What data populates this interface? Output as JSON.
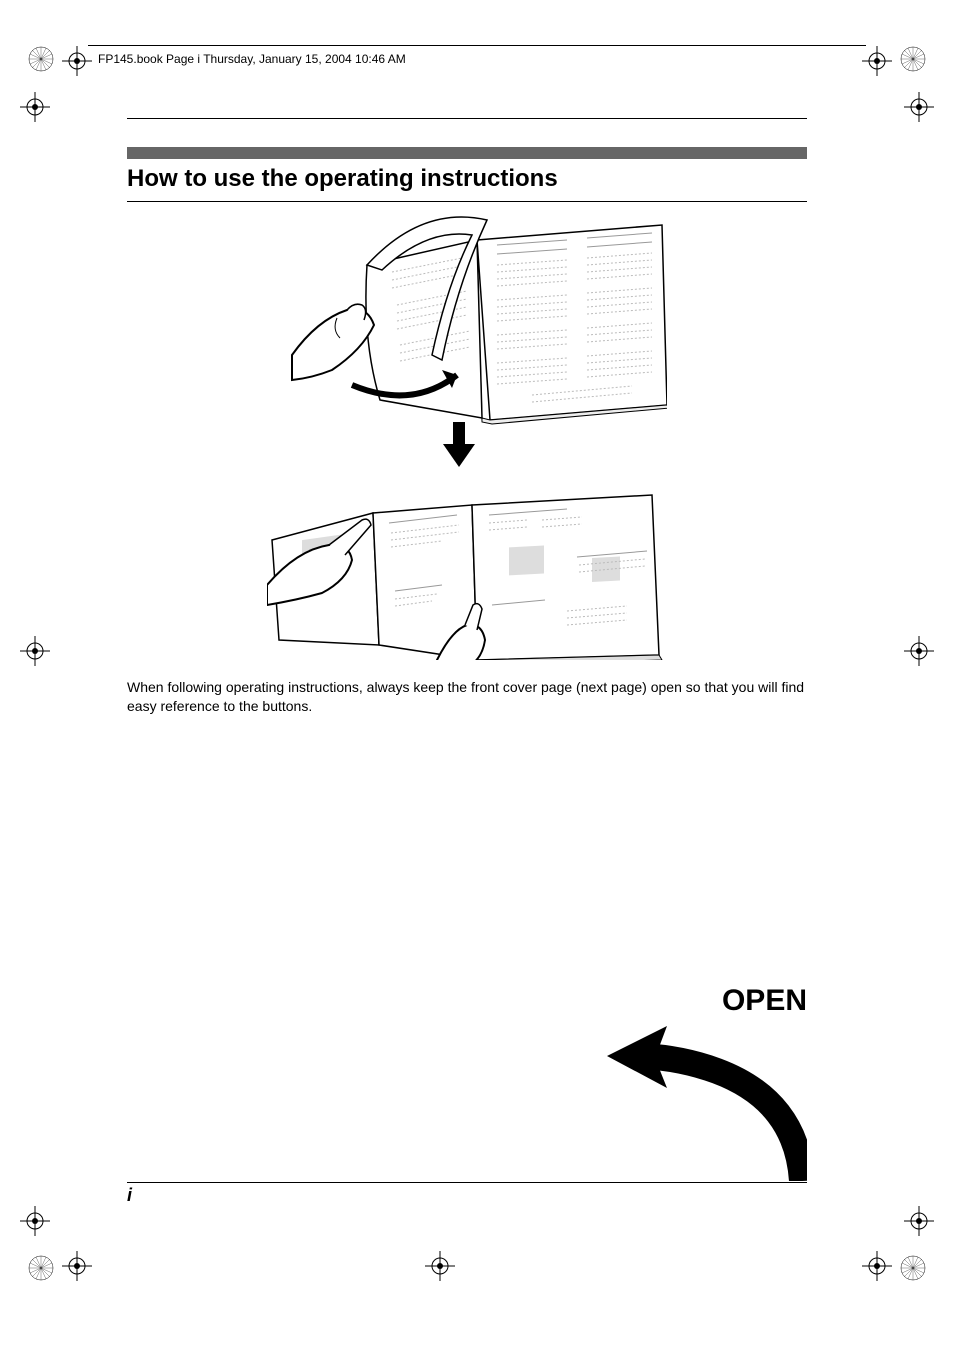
{
  "header": "FP145.book  Page i  Thursday, January 15, 2004  10:46 AM",
  "title": "How to use the operating instructions",
  "body": "When following operating instructions, always keep the front cover page (next page) open so that you will find easy reference to the buttons.",
  "open_label": "OPEN",
  "page_number": "i"
}
